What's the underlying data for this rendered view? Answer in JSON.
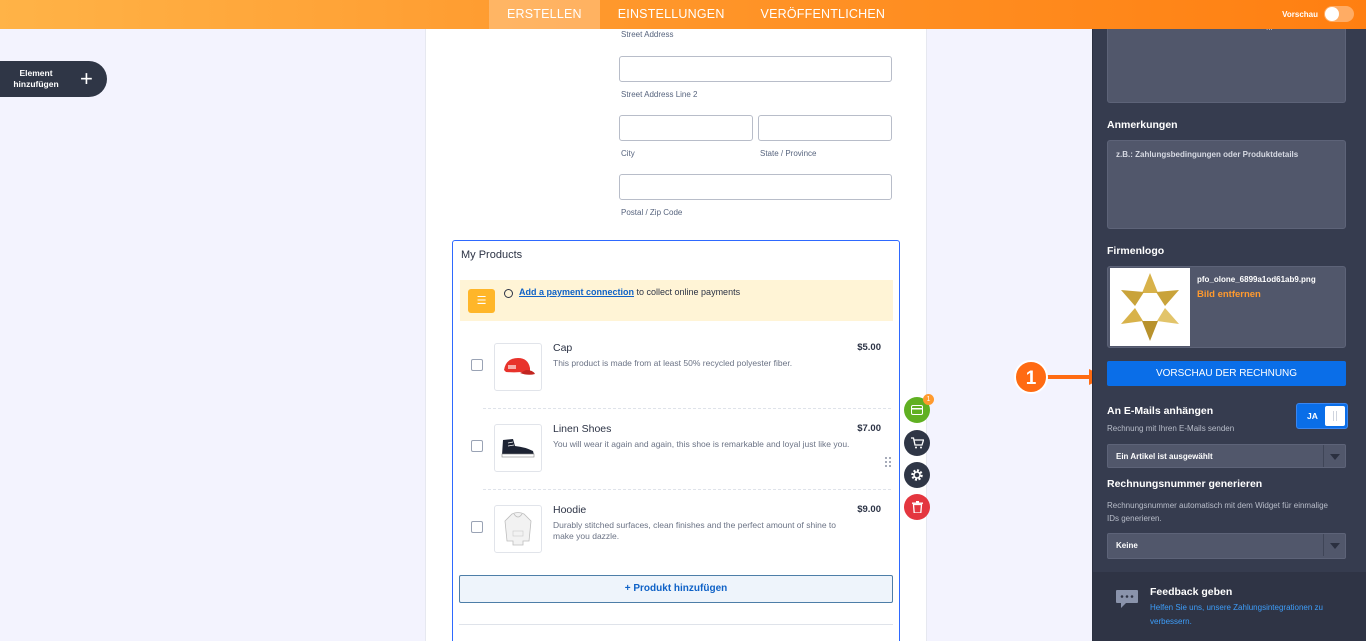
{
  "topbar": {
    "tabs": [
      {
        "label": "ERSTELLEN",
        "active": true
      },
      {
        "label": "EINSTELLUNGEN",
        "active": false
      },
      {
        "label": "VERÖFFENTLICHEN",
        "active": false
      }
    ],
    "preview_label": "Vorschau"
  },
  "add_element": {
    "label": "Element hinzufügen"
  },
  "address": {
    "street_label": "Street Address",
    "street2_label": "Street Address Line 2",
    "city_label": "City",
    "state_label": "State / Province",
    "zip_label": "Postal / Zip Code"
  },
  "products": {
    "title": "My Products",
    "payment_link": "Add a payment connection",
    "payment_text": " to collect online payments",
    "items": [
      {
        "name": "Cap",
        "price": "$5.00",
        "desc": "This product is made from at least 50% recycled polyester fiber."
      },
      {
        "name": "Linen Shoes",
        "price": "$7.00",
        "desc": "You will wear it again and again, this shoe is remarkable and loyal just like you."
      },
      {
        "name": "Hoodie",
        "price": "$9.00",
        "desc": "Durably stitched surfaces, clean finishes and the perfect amount of shine to make you dazzle."
      }
    ],
    "add_button": "+ Produkt hinzufügen"
  },
  "tools": {
    "badge": "1"
  },
  "annotation": {
    "number": "1"
  },
  "panel": {
    "top_text": "...",
    "notes_heading": "Anmerkungen",
    "notes_placeholder": "z.B.: Zahlungsbedingungen oder Produktdetails",
    "logo_heading": "Firmenlogo",
    "logo_file": "pfo_olone_6899a1od61ab9.png",
    "logo_remove": "Bild entfernen",
    "preview_button": "VORSCHAU DER RECHNUNG",
    "email_heading": "An E-Mails anhängen",
    "email_sub": "Rechnung mit Ihren E-Mails senden",
    "email_toggle": "JA",
    "email_dropdown": "Ein Artikel ist ausgewählt",
    "number_heading": "Rechnungsnummer generieren",
    "number_sub": "Rechnungsnummer automatisch mit dem Widget für einmalige IDs generieren.",
    "number_dropdown": "Keine",
    "feedback_title": "Feedback geben",
    "feedback_text": "Helfen Sie uns, unsere Zahlungsintegrationen zu verbessern."
  },
  "colors": {
    "accent_orange": "#ff7f11",
    "primary_blue": "#0a6ee8",
    "panel_bg": "#363c4f"
  }
}
